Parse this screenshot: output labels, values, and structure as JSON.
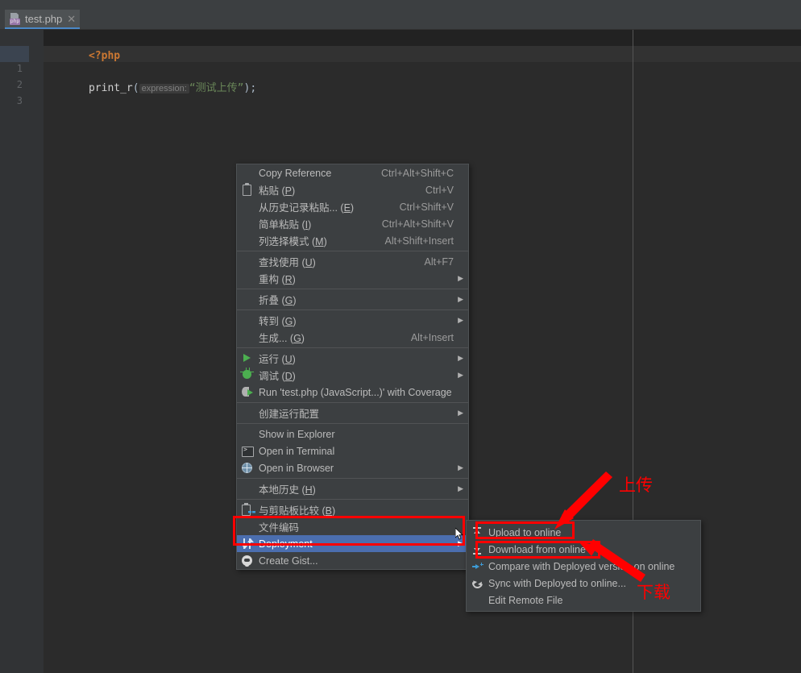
{
  "window": {
    "tab": {
      "title": "test.php",
      "icon": "php-file-icon",
      "close": "✕",
      "badge": "php"
    }
  },
  "editor": {
    "line_numbers": [
      "1",
      "2",
      "3"
    ],
    "code": {
      "line1": "<?php",
      "line3_fn": "print_r",
      "line3_open": "(",
      "line3_hint": "expression:",
      "line3_string": "“测试上传”",
      "line3_close": ")",
      "line3_semi": ";"
    }
  },
  "context_menu": {
    "items": [
      {
        "label": "Copy Reference",
        "accel": "Ctrl+Alt+Shift+C",
        "icon": "",
        "arrow": false,
        "name": "copy-reference"
      },
      {
        "label": "粘贴 (P)",
        "accel": "Ctrl+V",
        "icon": "clipboard-icon",
        "arrow": false,
        "name": "paste"
      },
      {
        "label": "从历史记录粘贴... (E)",
        "accel": "Ctrl+Shift+V",
        "icon": "",
        "arrow": false,
        "name": "paste-from-history"
      },
      {
        "label": "简单粘贴 (I)",
        "accel": "Ctrl+Alt+Shift+V",
        "icon": "",
        "arrow": false,
        "name": "paste-simple"
      },
      {
        "label": "列选择模式 (M)",
        "accel": "Alt+Shift+Insert",
        "icon": "",
        "arrow": false,
        "name": "column-selection-mode"
      },
      {
        "separator": true
      },
      {
        "label": "查找使用 (U)",
        "accel": "Alt+F7",
        "icon": "",
        "arrow": false,
        "name": "find-usages"
      },
      {
        "label": "重构 (R)",
        "accel": "",
        "icon": "",
        "arrow": true,
        "name": "refactor"
      },
      {
        "separator": true
      },
      {
        "label": "折叠 (G)",
        "accel": "",
        "icon": "",
        "arrow": true,
        "name": "folding"
      },
      {
        "separator": true
      },
      {
        "label": "转到 (G)",
        "accel": "",
        "icon": "",
        "arrow": true,
        "name": "goto"
      },
      {
        "label": "生成... (G)",
        "accel": "Alt+Insert",
        "icon": "",
        "arrow": false,
        "name": "generate"
      },
      {
        "separator": true
      },
      {
        "label": "运行 (U)",
        "accel": "",
        "icon": "run-icon",
        "arrow": true,
        "name": "run"
      },
      {
        "label": "调试 (D)",
        "accel": "",
        "icon": "debug-icon",
        "arrow": true,
        "name": "debug"
      },
      {
        "label": "Run 'test.php (JavaScript...)' with Coverage",
        "accel": "",
        "icon": "coverage-icon",
        "arrow": false,
        "name": "run-with-coverage"
      },
      {
        "separator": true
      },
      {
        "label": "创建运行配置",
        "accel": "",
        "icon": "",
        "arrow": true,
        "name": "create-run-configuration"
      },
      {
        "separator": true
      },
      {
        "label": "Show in Explorer",
        "accel": "",
        "icon": "",
        "arrow": false,
        "name": "show-in-explorer"
      },
      {
        "label": "Open in Terminal",
        "accel": "",
        "icon": "terminal-icon",
        "arrow": false,
        "name": "open-in-terminal"
      },
      {
        "label": "Open in Browser",
        "accel": "",
        "icon": "globe-icon",
        "arrow": true,
        "name": "open-in-browser"
      },
      {
        "separator": true
      },
      {
        "label": "本地历史 (H)",
        "accel": "",
        "icon": "",
        "arrow": true,
        "name": "local-history"
      },
      {
        "separator": true
      },
      {
        "label": "与剪贴板比较 (B)",
        "accel": "",
        "icon": "compare-clipboard-icon",
        "arrow": false,
        "name": "compare-with-clipboard"
      },
      {
        "label": "文件编码",
        "accel": "",
        "icon": "",
        "arrow": false,
        "name": "file-encoding"
      },
      {
        "label": "Deployment",
        "accel": "",
        "icon": "deployment-icon",
        "arrow": true,
        "selected": true,
        "name": "deployment"
      },
      {
        "label": "Create Gist...",
        "accel": "",
        "icon": "github-icon",
        "arrow": false,
        "name": "create-gist"
      }
    ]
  },
  "submenu": {
    "items": [
      {
        "label": "Upload to online",
        "icon": "upload-icon",
        "name": "upload-to-online"
      },
      {
        "label": "Download from online",
        "icon": "download-icon",
        "name": "download-from-online"
      },
      {
        "label": "Compare with Deployed version on online",
        "icon": "compare-icon",
        "name": "compare-with-deployed"
      },
      {
        "label": "Sync with Deployed to online...",
        "icon": "sync-icon",
        "name": "sync-with-deployed"
      },
      {
        "label": "Edit Remote File",
        "icon": "",
        "name": "edit-remote-file"
      }
    ]
  },
  "annotations": {
    "upload_label": "上传",
    "download_label": "下载",
    "color": "#ff0000"
  },
  "colors": {
    "accent": "#4b6eaf",
    "tab_underline": "#4a88c7",
    "menu_bg": "#3c3f41",
    "editor_bg": "#2b2b2b",
    "annotation_red": "#ff0000"
  }
}
